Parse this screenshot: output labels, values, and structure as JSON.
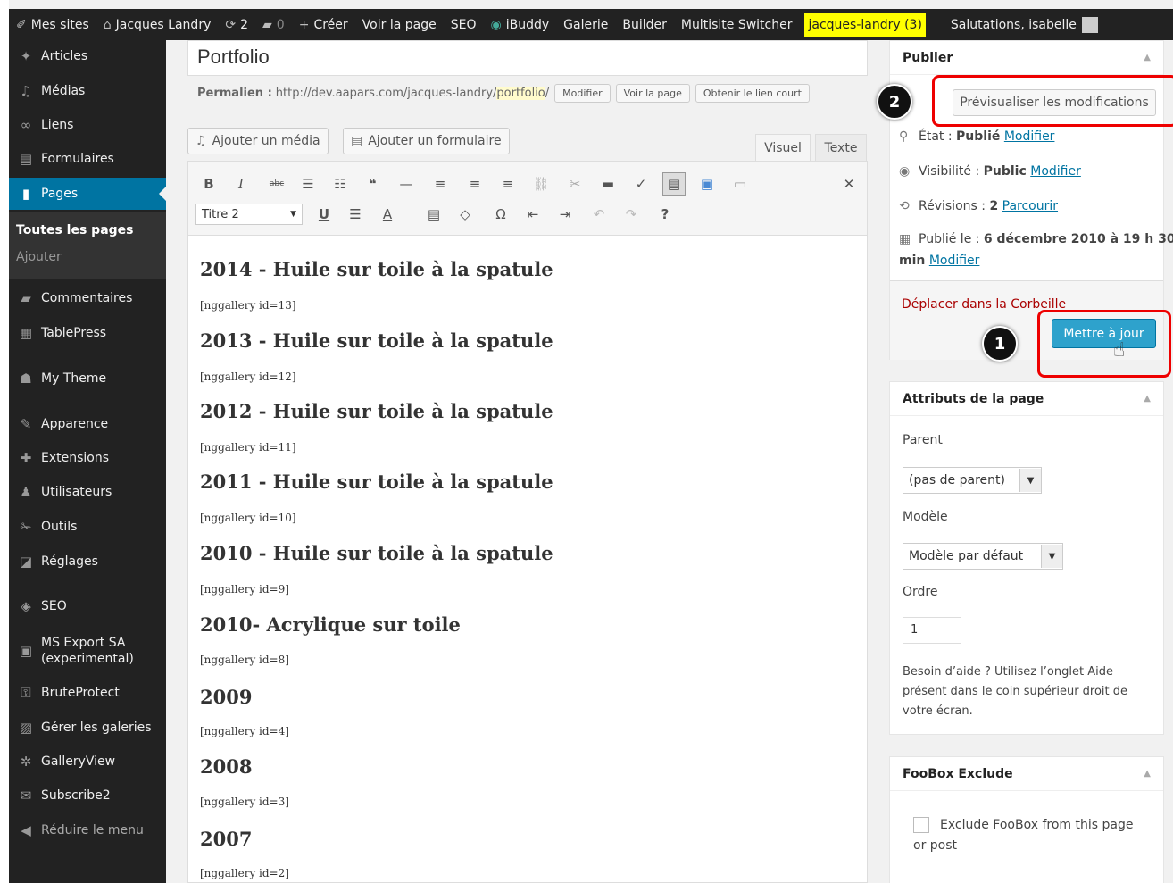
{
  "adminbar": {
    "items": [
      {
        "icon": "wp-logo-icon",
        "label": "Mes sites"
      },
      {
        "icon": "home-icon",
        "label": "Jacques Landry"
      },
      {
        "icon": "update-icon",
        "label": "2"
      },
      {
        "icon": "comment-icon",
        "label": "0"
      },
      {
        "icon": "plus-icon",
        "label": "Créer"
      },
      {
        "label": "Voir la page"
      },
      {
        "label": "SEO"
      },
      {
        "icon": "ibuddy-icon",
        "label": "iBuddy"
      },
      {
        "label": "Galerie"
      },
      {
        "label": "Builder"
      },
      {
        "label": "Multisite Switcher"
      }
    ],
    "site_switch": "jacques-landry (3)",
    "greeting": "Salutations, isabelle"
  },
  "sidebar": {
    "items": [
      {
        "label": "Articles"
      },
      {
        "label": "Médias"
      },
      {
        "label": "Liens"
      },
      {
        "label": "Formulaires"
      },
      {
        "label": "Pages"
      },
      {
        "label": "Commentaires"
      },
      {
        "label": "TablePress"
      },
      {
        "label": "My Theme"
      },
      {
        "label": "Apparence"
      },
      {
        "label": "Extensions"
      },
      {
        "label": "Utilisateurs"
      },
      {
        "label": "Outils"
      },
      {
        "label": "Réglages"
      },
      {
        "label": "SEO"
      },
      {
        "label": "MS Export SA (experimental)"
      },
      {
        "label": "BruteProtect"
      },
      {
        "label": "Gérer les galeries"
      },
      {
        "label": "GalleryView"
      },
      {
        "label": "Subscribe2"
      },
      {
        "label": "Réduire le menu"
      }
    ],
    "sub": [
      "Toutes les pages",
      "Ajouter"
    ]
  },
  "editor": {
    "title": "Portfolio",
    "permalink_label": "Permalien :",
    "permalink_base": "http://dev.aapars.com/jacques-landry/",
    "permalink_slug": "portfolio",
    "permalink_end": "/",
    "btn_modify": "Modifier",
    "btn_view": "Voir la page",
    "btn_shortlink": "Obtenir le lien court",
    "add_media": "Ajouter un média",
    "add_form": "Ajouter un formulaire",
    "tab_visual": "Visuel",
    "tab_text": "Texte",
    "format": "Titre 2",
    "content": [
      {
        "h": "2014 - Huile sur toile à la spatule",
        "p": "[nggallery id=13]"
      },
      {
        "h": "2013 - Huile sur toile à la spatule",
        "p": "[nggallery id=12]"
      },
      {
        "h": "2012 - Huile sur toile à la spatule",
        "p": "[nggallery id=11]"
      },
      {
        "h": "2011 - Huile sur toile à la spatule",
        "p": "[nggallery id=10]"
      },
      {
        "h": "2010 - Huile sur toile à la spatule",
        "p": "[nggallery id=9]"
      },
      {
        "h": "2010- Acrylique sur toile",
        "p": "[nggallery id=8]"
      },
      {
        "h": "2009",
        "p": "[nggallery id=4]"
      },
      {
        "h": "2008",
        "p": "[nggallery id=3]"
      },
      {
        "h": "2007",
        "p": "[nggallery id=2]"
      }
    ]
  },
  "publish": {
    "title": "Publier",
    "preview": "Prévisualiser les modifications",
    "status_label": "État :",
    "status_value": "Publié",
    "visibility_label": "Visibilité :",
    "visibility_value": "Public",
    "revisions_label": "Révisions :",
    "revisions_value": "2",
    "browse": "Parcourir",
    "published_label": "Publié le :",
    "published_value": "6 décembre 2010 à 19 h 30",
    "published_value2": "min",
    "modify": "Modifier",
    "trash": "Déplacer dans la Corbeille",
    "update": "Mettre à jour"
  },
  "attributes": {
    "title": "Attributs de la page",
    "parent_label": "Parent",
    "parent_value": "(pas de parent)",
    "template_label": "Modèle",
    "template_value": "Modèle par défaut",
    "order_label": "Ordre",
    "order_value": "1",
    "help1": "Besoin d’aide ? Utilisez l’onglet Aide",
    "help2": "présent dans le coin supérieur droit de",
    "help3": "votre écran."
  },
  "foobox": {
    "title": "FooBox Exclude",
    "label1": "Exclude FooBox from this page",
    "label2": "or post"
  },
  "callouts": {
    "one": "1",
    "two": "2"
  },
  "colors": {
    "accent": "#0074a2",
    "adminbar": "#222222",
    "callout": "#ee0000",
    "highlight": "#ffff00"
  }
}
